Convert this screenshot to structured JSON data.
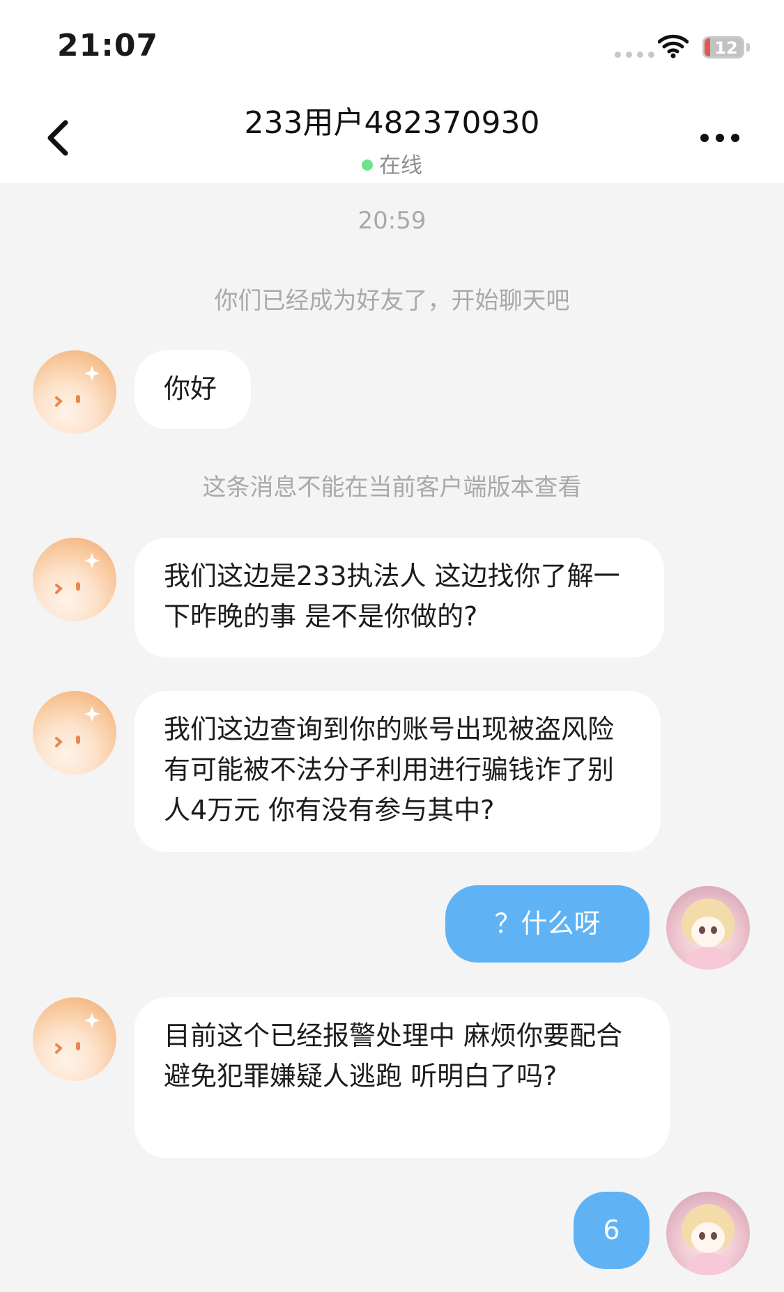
{
  "status_bar": {
    "time": "21:07",
    "battery": "12"
  },
  "header": {
    "title": "233用户482370930",
    "presence": "在线"
  },
  "icons": {
    "back": "chevron-left-icon",
    "more": "more-horizontal-icon",
    "wifi": "wifi-icon",
    "battery": "battery-icon",
    "signal": "signal-icon"
  },
  "colors": {
    "outgoing_bubble": "#5fb2f4",
    "online_dot": "#6fe28b",
    "battery_low": "#e05a55"
  },
  "chat": {
    "timestamp": "20:59",
    "system_friend": "你们已经成为好友了，开始聊天吧",
    "system_unsupported": "这条消息不能在当前客户端版本查看",
    "messages": [
      {
        "from": "other",
        "text": "你好"
      },
      {
        "from": "other",
        "text": "我们这边是233执法人 这边找你了解一下昨晚的事 是不是你做的?"
      },
      {
        "from": "other",
        "text": "我们这边查询到你的账号出现被盗风险 有可能被不法分子利用进行骗钱诈了别人4万元 你有没有参与其中?"
      },
      {
        "from": "me",
        "text": "？什么呀"
      },
      {
        "from": "other",
        "text": "目前这个已经报警处理中 麻烦你要配合 避免犯罪嫌疑人逃跑 听明白了吗?"
      },
      {
        "from": "me",
        "text": "6"
      }
    ]
  }
}
